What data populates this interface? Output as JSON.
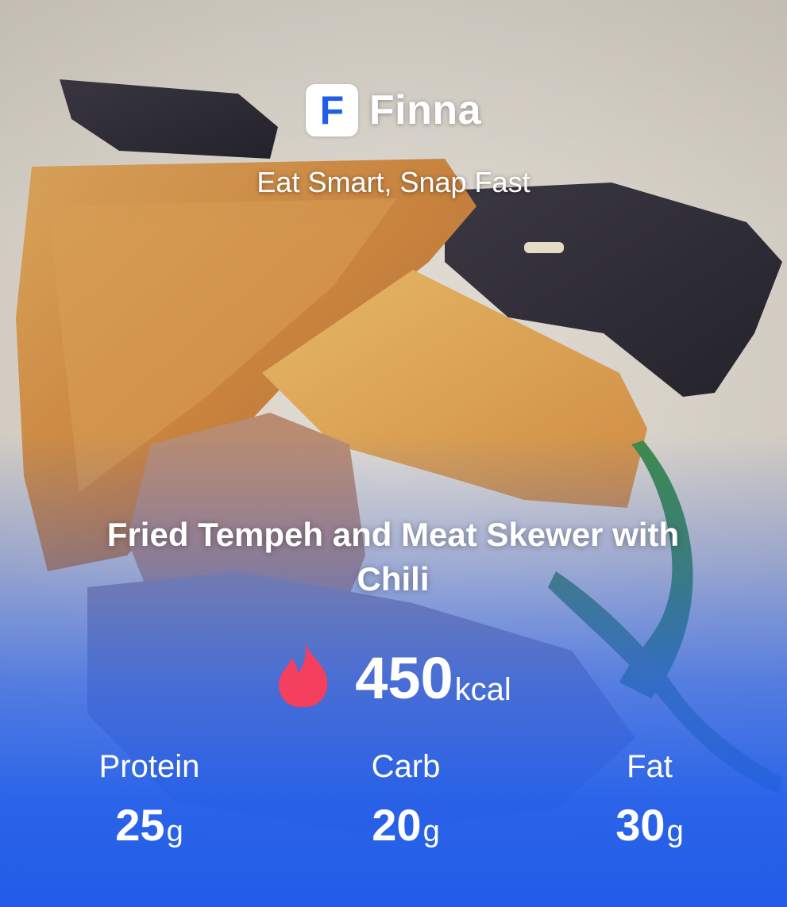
{
  "app": {
    "logo_letter": "F",
    "name": "Finna",
    "tagline": "Eat Smart, Snap Fast"
  },
  "meal": {
    "title": "Fried Tempeh and Meat Skewer with Chili",
    "calories": {
      "value": "450",
      "unit": "kcal",
      "icon": "flame-icon"
    },
    "macros": [
      {
        "label": "Protein",
        "value": "25",
        "unit": "g"
      },
      {
        "label": "Carb",
        "value": "20",
        "unit": "g"
      },
      {
        "label": "Fat",
        "value": "30",
        "unit": "g"
      }
    ]
  },
  "colors": {
    "accent": "#1f5fe6",
    "flame": "#f43f5e",
    "overlay": "#215ce8"
  }
}
